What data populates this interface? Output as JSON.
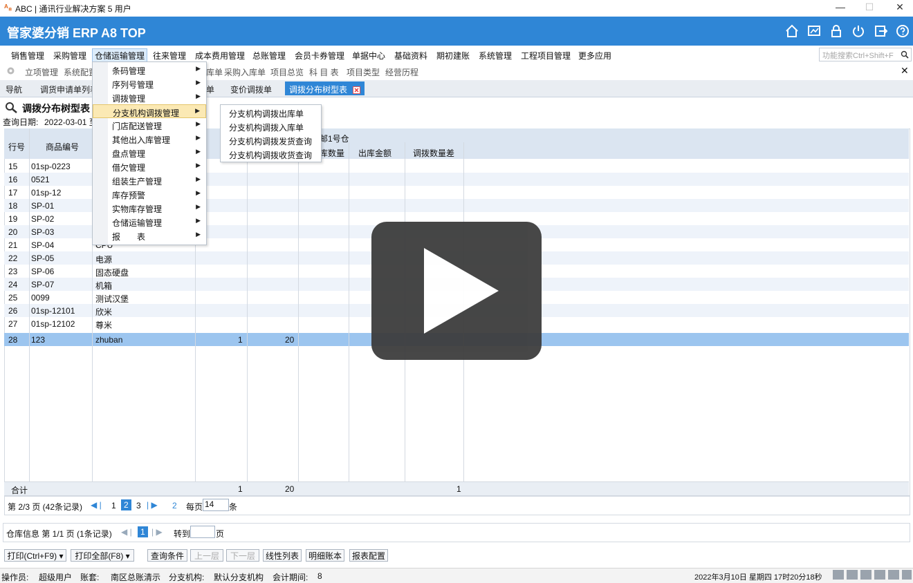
{
  "window": {
    "logo": "ᴬ₈",
    "title": "ABC  | 通讯行业解决方案 5 用户",
    "minimize": "—",
    "maximize": "☐",
    "close": "✕"
  },
  "header": {
    "app_title": "管家婆分销 ERP A8 TOP",
    "icons": [
      "home-icon",
      "chart-icon",
      "lock-icon",
      "power-icon",
      "exit-icon",
      "help-icon"
    ]
  },
  "menubar": {
    "items": [
      "销售管理",
      "采购管理",
      "仓储运输管理",
      "往来管理",
      "成本费用管理",
      "总账管理",
      "会员卡券管理",
      "单据中心",
      "基础资料",
      "期初建账",
      "系统管理",
      "工程项目管理",
      "更多应用"
    ],
    "search_placeholder": "功能搜索Ctrl+Shift+F"
  },
  "toolbar": {
    "links": [
      "立项管理",
      "系统配置",
      "库单",
      "采购入库单",
      "项目总览",
      "科 目 表",
      "项目类型",
      "经营历程"
    ],
    "close": "✕"
  },
  "tabs": {
    "items": [
      "导航",
      "调货申请单列表",
      "单",
      "变价调拨单",
      "调拨分布树型表"
    ]
  },
  "report": {
    "title": "调拨分布树型表",
    "query_date_label": "查询日期:",
    "query_date_value": "2022-03-01 至"
  },
  "table": {
    "group_header": "邮1号仓",
    "columns": [
      "行号",
      "商品编号",
      "库数量",
      "出库金额",
      "调拨数量差"
    ],
    "rows": [
      {
        "no": "15",
        "code": "01sp-0223",
        "name": "",
        "qty": "",
        "amt": ""
      },
      {
        "no": "16",
        "code": "0521",
        "name": "",
        "qty": "",
        "amt": ""
      },
      {
        "no": "17",
        "code": "01sp-12",
        "name": "",
        "qty": "",
        "amt": ""
      },
      {
        "no": "18",
        "code": "SP-01",
        "name": "",
        "qty": "",
        "amt": ""
      },
      {
        "no": "19",
        "code": "SP-02",
        "name": "",
        "qty": "",
        "amt": ""
      },
      {
        "no": "20",
        "code": "SP-03",
        "name": "",
        "qty": "",
        "amt": ""
      },
      {
        "no": "21",
        "code": "SP-04",
        "name": "CPU",
        "qty": "",
        "amt": ""
      },
      {
        "no": "22",
        "code": "SP-05",
        "name": "电源",
        "qty": "",
        "amt": ""
      },
      {
        "no": "23",
        "code": "SP-06",
        "name": "固态硬盘",
        "qty": "",
        "amt": ""
      },
      {
        "no": "24",
        "code": "SP-07",
        "name": "机箱",
        "qty": "",
        "amt": ""
      },
      {
        "no": "25",
        "code": "0099",
        "name": "测试汉堡",
        "qty": "",
        "amt": ""
      },
      {
        "no": "26",
        "code": "01sp-12101",
        "name": "欣米",
        "qty": "",
        "amt": ""
      },
      {
        "no": "27",
        "code": "01sp-12102",
        "name": "尊米",
        "qty": "",
        "amt": ""
      },
      {
        "no": "28",
        "code": "123",
        "name": "zhuban",
        "qty": "1",
        "amt": "20"
      }
    ],
    "total": {
      "label": "合计",
      "qty": "1",
      "amt": "20",
      "diff": "1"
    }
  },
  "pagination": {
    "info": "第 2/3 页 (42条记录)",
    "pages": [
      "1",
      "2",
      "3"
    ],
    "last": "2",
    "per_page_label": "每页",
    "per_page_value": "14",
    "unit": "条"
  },
  "warehouse_pager": {
    "info": "仓库信息 第 1/1 页 (1条记录)",
    "page": "1",
    "goto_label": "转到",
    "page_unit": "页"
  },
  "buttons": [
    "打印(Ctrl+F9)",
    "打印全部(F8)",
    "查询条件",
    "上一层",
    "下一层",
    "线性列表",
    "明细账本",
    "报表配置"
  ],
  "status": {
    "operator_label": "操作员:",
    "operator": "超级用户",
    "account_label": "账套:",
    "account": "南区总账清示",
    "branch_label": "分支机构:",
    "branch": "默认分支机构",
    "period_label": "会计期间:",
    "period": "8",
    "datetime": "2022年3月10日 星期四 17时20分18秒"
  },
  "dropdown": {
    "items": [
      "条码管理",
      "序列号管理",
      "调拨管理",
      "分支机构调拨管理",
      "门店配送管理",
      "其他出入库管理",
      "盘点管理",
      "借欠管理",
      "组装生产管理",
      "库存预警",
      "实物库存管理",
      "仓储运输管理",
      "报　　表"
    ],
    "submenu": [
      "分支机构调拨出库单",
      "分支机构调拨入库单",
      "分支机构调拨发货查询",
      "分支机构调拨收货查询"
    ]
  },
  "colors": {
    "header": "#2f86d6",
    "selected_row": "#9cc5ef",
    "highlight": "#fbe9b4"
  }
}
